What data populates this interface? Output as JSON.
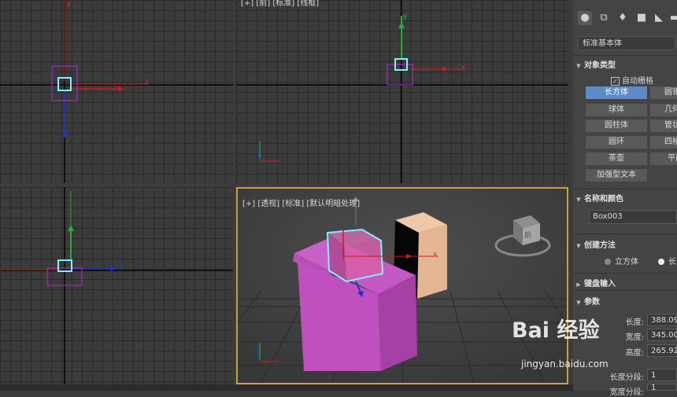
{
  "viewports": {
    "top_label": "[+] [前] [标准] [线框]",
    "persp_label": "[+] [透视] [标准] [默认明暗处理]",
    "y_label": "y",
    "x_label": "x",
    "z_label": "z",
    "viewcube_label": "前"
  },
  "panel": {
    "tabs": [
      "create-icon",
      "modify-icon",
      "hierarchy-icon",
      "motion-icon",
      "display-icon",
      "utilities-icon"
    ],
    "category": "标准基本体",
    "object_type": {
      "title": "对象类型",
      "autogrid": "自动栅格",
      "buttons": [
        "长方体",
        "圆锥体",
        "球体",
        "几何球体",
        "圆柱体",
        "管状体",
        "圆环",
        "四棱锥",
        "茶壶",
        "平面",
        "加强型文本"
      ]
    },
    "name_color": {
      "title": "名称和颜色",
      "name": "Box003",
      "swatch_color": "#c04fc0"
    },
    "creation": {
      "title": "创建方法",
      "option1": "立方体",
      "option2": "长方体"
    },
    "keyboard": {
      "title": "键盘输入"
    },
    "params": {
      "title": "参数",
      "length_label": "长度:",
      "length": "388.09",
      "width_label": "宽度:",
      "width": "345.00",
      "height_label": "高度:",
      "height": "265.92",
      "lseg_label": "长度分段:",
      "lseg": "1",
      "wseg_label": "宽度分段:",
      "wseg": "1"
    }
  },
  "watermark": {
    "main": "Bai 经验",
    "sub": "jingyan.baidu.com"
  }
}
